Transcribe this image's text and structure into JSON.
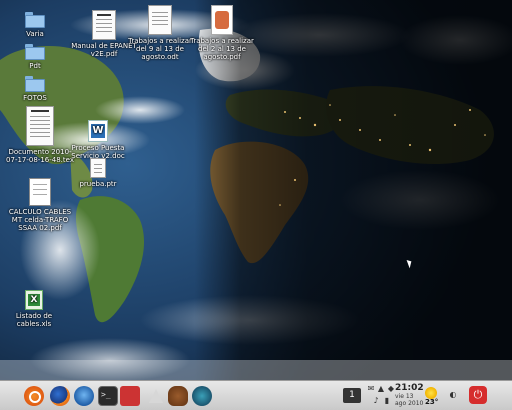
{
  "desktop": {
    "icons": [
      {
        "name": "folder-1",
        "label": "Varia",
        "type": "folder"
      },
      {
        "name": "folder-2",
        "label": "Pdt",
        "type": "folder"
      },
      {
        "name": "folder-3",
        "label": "FOTOS",
        "type": "folder"
      },
      {
        "name": "pdf-epanet",
        "label": "Manual de EPANET v2E.pdf",
        "type": "doc"
      },
      {
        "name": "pdf-trabajos",
        "label": "Trabajos a realizar del 9 al 13 de agosto.odt",
        "type": "doc"
      },
      {
        "name": "pdf-trabajos-2",
        "label": "Trabajos a realizar del 2 al 13 de agosto.pdf",
        "type": "map"
      },
      {
        "name": "doc-documento",
        "label": "Documento 2010-07-17-08-16-48.tex",
        "type": "doc"
      },
      {
        "name": "doc-proceso",
        "label": "Proceso Puesta Servicio v2.doc",
        "type": "word"
      },
      {
        "name": "doc-prueba",
        "label": "prueba.ptr",
        "type": "doc"
      },
      {
        "name": "pdf-calculo",
        "label": "CALCULO CABLES MT celda-TRAFO SSAA 02.pdf",
        "type": "pdf"
      },
      {
        "name": "xls-listado",
        "label": "Listado de cables.xls",
        "type": "excel"
      }
    ]
  },
  "panel": {
    "launchers": [
      "ubuntu-icon",
      "firefox-icon",
      "thunderbird-icon",
      "terminal-icon",
      "app-icon",
      "tent-icon",
      "gnu-icon",
      "browser-icon"
    ],
    "workspace": "1",
    "clock_time": "21:02",
    "clock_line1": "vie 13",
    "clock_line2": "ago 2010",
    "weather_temp": "23°"
  }
}
